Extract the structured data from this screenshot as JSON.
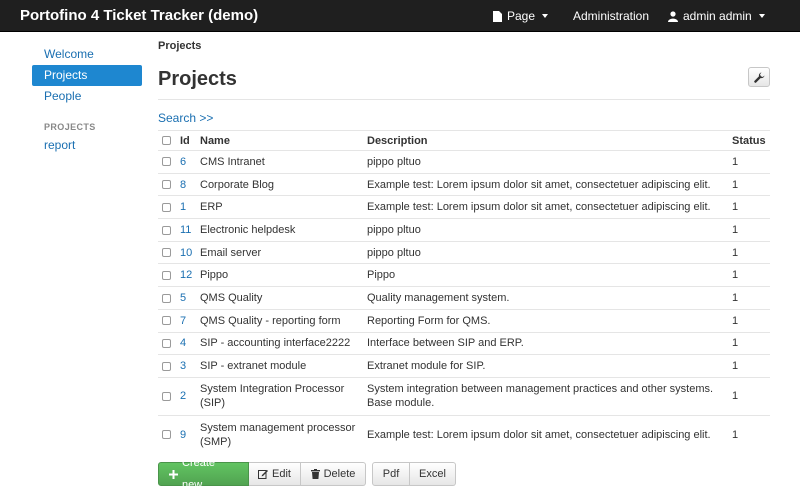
{
  "navbar": {
    "brand": "Portofino 4 Ticket Tracker (demo)",
    "page_menu": "Page",
    "administration": "Administration",
    "user_menu": "admin admin"
  },
  "sidebar": {
    "items": [
      {
        "label": "Welcome",
        "active": false
      },
      {
        "label": "Projects",
        "active": true
      },
      {
        "label": "People",
        "active": false
      }
    ],
    "section_header": "PROJECTS",
    "section_items": [
      {
        "label": "report"
      }
    ]
  },
  "main": {
    "breadcrumb": "Projects",
    "title": "Projects",
    "search_link": "Search >>",
    "table": {
      "columns": [
        "Id",
        "Name",
        "Description",
        "Status"
      ],
      "rows": [
        {
          "id": "6",
          "name": "CMS Intranet",
          "description": "pippo pltuo",
          "status": "1"
        },
        {
          "id": "8",
          "name": "Corporate Blog",
          "description": "Example test: Lorem ipsum dolor sit amet, consectetuer adipiscing elit.",
          "status": "1"
        },
        {
          "id": "1",
          "name": "ERP",
          "description": "Example test: Lorem ipsum dolor sit amet, consectetuer adipiscing elit.",
          "status": "1"
        },
        {
          "id": "11",
          "name": "Electronic helpdesk",
          "description": "pippo pltuo",
          "status": "1"
        },
        {
          "id": "10",
          "name": "Email server",
          "description": "pippo pltuo",
          "status": "1"
        },
        {
          "id": "12",
          "name": "Pippo",
          "description": "Pippo",
          "status": "1"
        },
        {
          "id": "5",
          "name": "QMS Quality",
          "description": "Quality management system.",
          "status": "1"
        },
        {
          "id": "7",
          "name": "QMS Quality - reporting form",
          "description": "Reporting Form for QMS.",
          "status": "1"
        },
        {
          "id": "4",
          "name": "SIP - accounting interface2222",
          "description": "Interface between SIP and ERP.",
          "status": "1"
        },
        {
          "id": "3",
          "name": "SIP - extranet module",
          "description": "Extranet module for SIP.",
          "status": "1"
        },
        {
          "id": "2",
          "name": "System Integration Processor (SIP)",
          "description": "System integration between management practices and other systems. Base module.",
          "status": "1"
        },
        {
          "id": "9",
          "name": "System management processor (SMP)",
          "description": "Example test: Lorem ipsum dolor sit amet, consectetuer adipiscing elit.",
          "status": "1"
        }
      ]
    }
  },
  "buttons": {
    "create": "Create new",
    "edit": "Edit",
    "delete": "Delete",
    "pdf": "Pdf",
    "excel": "Excel"
  },
  "colors": {
    "navbar_bg": "#1f1f1f",
    "link": "#1a6fb1",
    "active_nav": "#1e87d0",
    "create_button": "#5bb75b"
  }
}
